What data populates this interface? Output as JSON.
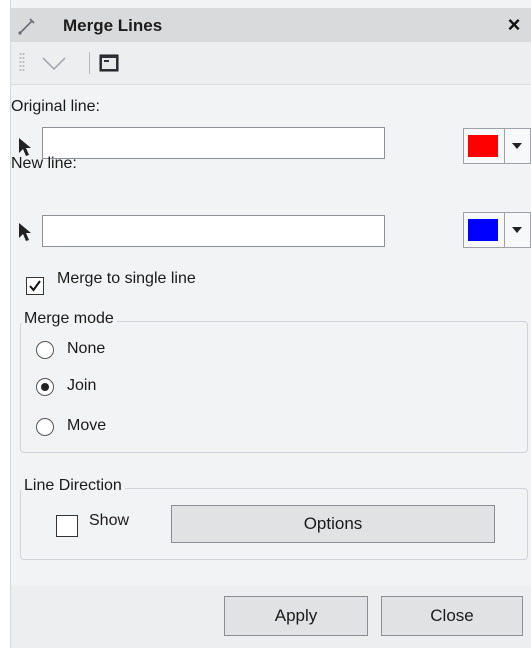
{
  "window": {
    "title": "Merge Lines",
    "close_glyph": "×",
    "title_icon": "line-edit-icon"
  },
  "toolbar": {
    "dropdown_icon": "chevron-down-icon",
    "button_icon": "console-icon"
  },
  "original_line": {
    "label": "Original line:",
    "value": "",
    "picker_icon": "pointer-arrow-icon",
    "color": "#ff0000"
  },
  "new_line": {
    "label": "New line:",
    "value": "",
    "picker_icon": "pointer-arrow-icon",
    "color": "#0000ff"
  },
  "merge_single": {
    "label": "Merge to single line",
    "checked": true
  },
  "merge_mode": {
    "title": "Merge mode",
    "options": [
      {
        "label": "None",
        "selected": false
      },
      {
        "label": "Join",
        "selected": true
      },
      {
        "label": "Move",
        "selected": false
      }
    ]
  },
  "line_direction": {
    "title": "Line Direction",
    "show_label": "Show",
    "show_checked": false,
    "options_button": "Options"
  },
  "footer": {
    "apply_button": "Apply",
    "close_button": "Close"
  }
}
